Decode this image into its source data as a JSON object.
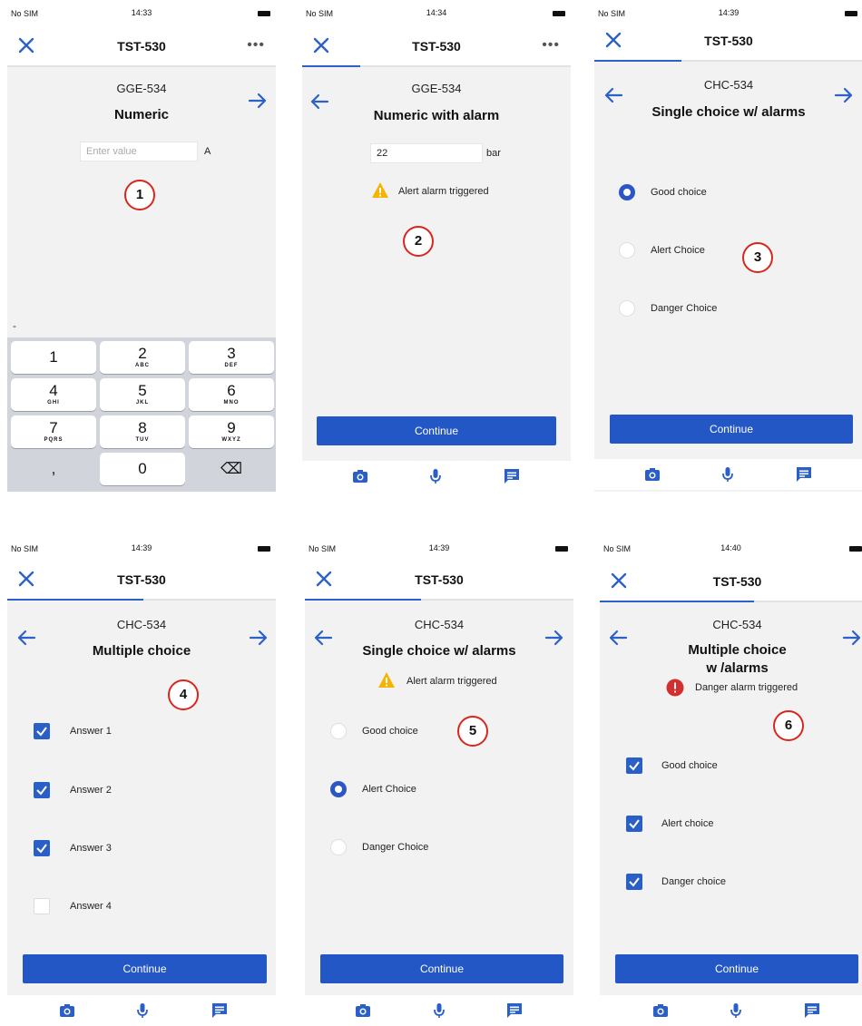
{
  "status": {
    "carrier": "No SIM",
    "times": [
      "14:33",
      "14:34",
      "14:39",
      "14:39",
      "14:39",
      "14:40"
    ]
  },
  "nav": {
    "title": "TST-530",
    "more": "•••"
  },
  "continue_label": "Continue",
  "markers": [
    "1",
    "2",
    "3",
    "4",
    "5",
    "6"
  ],
  "screen1": {
    "code": "GGE-534",
    "title": "Numeric",
    "placeholder": "Enter value",
    "unit": "A",
    "minus": "-",
    "keys": [
      {
        "digit": "1",
        "letters": ""
      },
      {
        "digit": "2",
        "letters": "ABC"
      },
      {
        "digit": "3",
        "letters": "DEF"
      },
      {
        "digit": "4",
        "letters": "GHI"
      },
      {
        "digit": "5",
        "letters": "JKL"
      },
      {
        "digit": "6",
        "letters": "MNO"
      },
      {
        "digit": "7",
        "letters": "PQRS"
      },
      {
        "digit": "8",
        "letters": "TUV"
      },
      {
        "digit": "9",
        "letters": "WXYZ"
      },
      {
        "digit": ",",
        "letters": ""
      },
      {
        "digit": "0",
        "letters": ""
      },
      {
        "digit": "⌫",
        "letters": ""
      }
    ]
  },
  "screen2": {
    "code": "GGE-534",
    "title": "Numeric with alarm",
    "value": "22",
    "unit": "bar",
    "alarm": "Alert alarm triggered"
  },
  "screen3": {
    "code": "CHC-534",
    "title": "Single choice w/ alarms",
    "options": [
      {
        "label": "Good choice",
        "selected": true
      },
      {
        "label": "Alert Choice",
        "selected": false
      },
      {
        "label": "Danger Choice",
        "selected": false
      }
    ]
  },
  "screen4": {
    "code": "CHC-534",
    "title": "Multiple choice",
    "options": [
      {
        "label": "Answer 1",
        "checked": true
      },
      {
        "label": "Answer 2",
        "checked": true
      },
      {
        "label": "Answer 3",
        "checked": true
      },
      {
        "label": "Answer 4",
        "checked": false
      }
    ]
  },
  "screen5": {
    "code": "CHC-534",
    "title": "Single choice w/ alarms",
    "alarm": "Alert alarm triggered",
    "options": [
      {
        "label": "Good choice",
        "selected": false
      },
      {
        "label": "Alert Choice",
        "selected": true
      },
      {
        "label": "Danger Choice",
        "selected": false
      }
    ]
  },
  "screen6": {
    "code": "CHC-534",
    "title_line1": "Multiple choice",
    "title_line2": "w /alarms",
    "alarm": "Danger alarm triggered",
    "options": [
      {
        "label": "Good choice",
        "checked": true
      },
      {
        "label": "Alert choice",
        "checked": true
      },
      {
        "label": "Danger choice",
        "checked": true
      }
    ]
  },
  "colors": {
    "accent": "#2457c6",
    "alert": "#f4b400",
    "danger": "#d32f2f",
    "marker": "#d9261c"
  },
  "icons": [
    "close-icon",
    "more-icon",
    "arrow-left-icon",
    "arrow-right-icon",
    "camera-icon",
    "microphone-icon",
    "comment-icon",
    "warning-icon",
    "danger-icon",
    "backspace-icon",
    "check-icon"
  ]
}
